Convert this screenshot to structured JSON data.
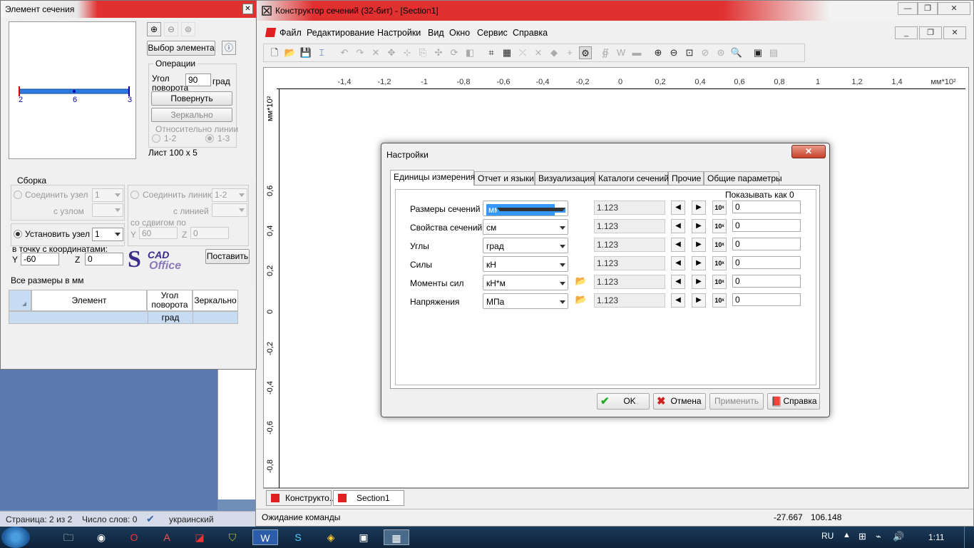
{
  "word": {
    "status_page": "Страница: 2 из 2",
    "status_words": "Число слов: 0",
    "status_lang": "украинский"
  },
  "app": {
    "title": "Конструктор сечений (32-бит) - [Section1]",
    "menu": [
      "Файл",
      "Редактирование",
      "Настройки",
      "Вид",
      "Окно",
      "Сервис",
      "Справка"
    ],
    "ruler_unit": "мм*10²",
    "ruler_x": [
      "-1,4",
      "-1,2",
      "-1",
      "-0,8",
      "-0,6",
      "-0,4",
      "-0,2",
      "0",
      "0,2",
      "0,4",
      "0,6",
      "0,8",
      "1",
      "1,2",
      "1,4"
    ],
    "ruler_y": [
      "0,6",
      "0,4",
      "0,2",
      "0",
      "-0,2",
      "-0,4",
      "-0,6",
      "-0,8"
    ],
    "doc_tabs": [
      "Конструкто...",
      "Section1"
    ],
    "status_text": "Ожидание команды",
    "coord_x": "-27.667",
    "coord_y": "106.148"
  },
  "panel": {
    "title": "Элемент сечения",
    "select_element_btn": "Выбор элемента",
    "operations_label": "Операции",
    "angle_label_1": "Угол",
    "angle_label_2": "поворота",
    "angle_value": "90",
    "angle_unit": "град",
    "rotate_btn": "Повернуть",
    "mirror_btn": "Зеркально",
    "relative_line": "Относительно линии",
    "radio_12": "1-2",
    "radio_13": "1-3",
    "sheet_label": "Лист 100 x 5",
    "node_labels": [
      "2",
      "6",
      "3"
    ],
    "assembly_label": "Сборка",
    "connect_node": "Соединить узел",
    "connect_node_val": "1",
    "with_node": "с узлом",
    "connect_line": "Соединить линию",
    "connect_line_val": "1-2",
    "with_line": "с линией",
    "with_shift": "со сдвигом по",
    "shift_y_label": "Y",
    "shift_y": "60",
    "shift_z_label": "Z",
    "shift_z": "0",
    "set_node": "Установить узел",
    "set_node_val": "1",
    "to_point": "в точку с координатами:",
    "y_label": "Y",
    "y_value": "-60",
    "z_label": "Z",
    "z_value": "0",
    "logo_top": "CAD",
    "logo_bottom": "Office",
    "place_btn": "Поставить",
    "all_sizes": "Все размеры в мм",
    "table_headers": [
      "Элемент",
      "Угол поворота",
      "Зеркально"
    ],
    "table_row_unit": "град"
  },
  "dialog": {
    "title": "Настройки",
    "tabs": [
      "Единицы измерения",
      "Отчет и языки",
      "Визуализация",
      "Каталоги сечений",
      "Прочие",
      "Общие параметры"
    ],
    "show_as_zero": "Показывать как 0",
    "rows": [
      {
        "label": "Размеры сечений",
        "unit": "мм",
        "num": "1.123",
        "zero": "0",
        "folder": false
      },
      {
        "label": "Свойства сечений",
        "unit": "см",
        "num": "1.123",
        "zero": "0",
        "folder": false
      },
      {
        "label": "Углы",
        "unit": "град",
        "num": "1.123",
        "zero": "0",
        "folder": false
      },
      {
        "label": "Силы",
        "unit": "кН",
        "num": "1.123",
        "zero": "0",
        "folder": false
      },
      {
        "label": "Моменты сил",
        "unit": "кН*м",
        "num": "1.123",
        "zero": "0",
        "folder": true
      },
      {
        "label": "Напряжения",
        "unit": "МПа",
        "num": "1.123",
        "zero": "0",
        "folder": true
      }
    ],
    "ok": "OK",
    "cancel": "Отмена",
    "apply": "Применить",
    "help": "Справка"
  },
  "taskbar": {
    "lang": "RU",
    "time": "1:11"
  }
}
